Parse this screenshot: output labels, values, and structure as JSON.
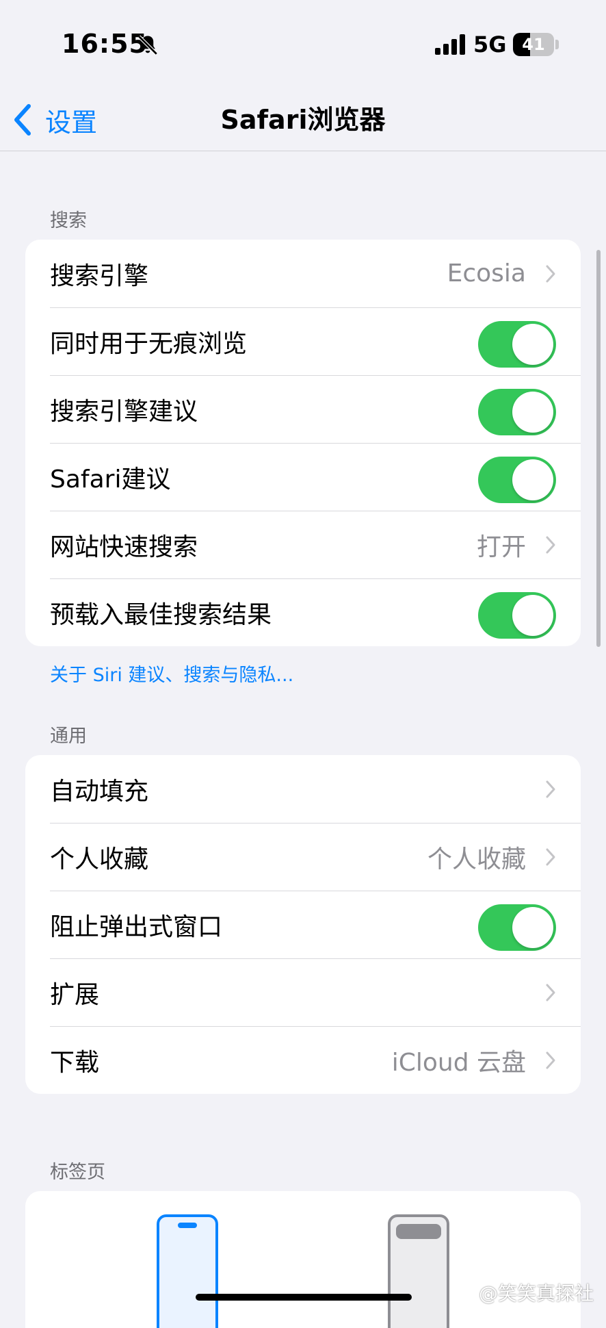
{
  "status_bar": {
    "time": "16:55",
    "network": "5G",
    "battery_level": "41",
    "battery_fraction": 0.41
  },
  "nav": {
    "back_label": "设置",
    "title": "Safari浏览器"
  },
  "search_section": {
    "header": "搜索",
    "rows": [
      {
        "label": "搜索引擎",
        "value": "Ecosia",
        "kind": "link"
      },
      {
        "label": "同时用于无痕浏览",
        "kind": "toggle",
        "on": true
      },
      {
        "label": "搜索引擎建议",
        "kind": "toggle",
        "on": true
      },
      {
        "label": "Safari建议",
        "kind": "toggle",
        "on": true
      },
      {
        "label": "网站快速搜索",
        "value": "打开",
        "kind": "link"
      },
      {
        "label": "预载入最佳搜索结果",
        "kind": "toggle",
        "on": true
      }
    ],
    "footer": "关于 Siri 建议、搜索与隐私..."
  },
  "general_section": {
    "header": "通用",
    "rows": [
      {
        "label": "自动填充",
        "kind": "link"
      },
      {
        "label": "个人收藏",
        "value": "个人收藏",
        "kind": "link"
      },
      {
        "label": "阻止弹出式窗口",
        "kind": "toggle",
        "on": true
      },
      {
        "label": "扩展",
        "kind": "link"
      },
      {
        "label": "下载",
        "value": "iCloud 云盘",
        "kind": "link"
      }
    ]
  },
  "tabs_section": {
    "header": "标签页"
  },
  "watermark": "@笑笑真探社",
  "colors": {
    "accent": "#0a84ff",
    "toggle_on": "#34c759",
    "background": "#f2f2f7"
  }
}
